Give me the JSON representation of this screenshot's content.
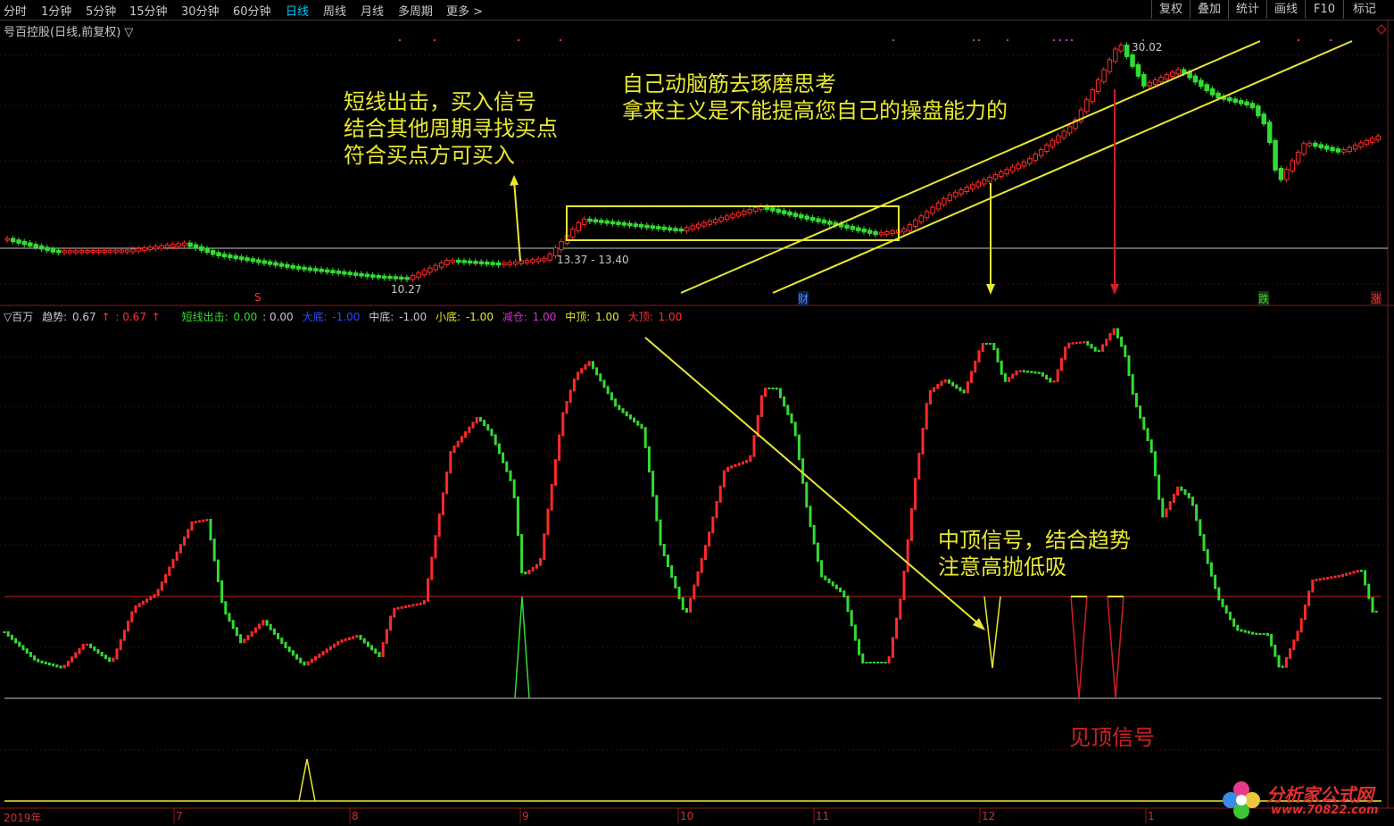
{
  "toolbar": {
    "periods": [
      "分时",
      "1分钟",
      "5分钟",
      "15分钟",
      "30分钟",
      "60分钟",
      "日线",
      "周线",
      "月线",
      "多周期",
      "更多 >"
    ],
    "active_period": "日线",
    "right_buttons": [
      "复权",
      "叠加",
      "统计",
      "画线",
      "F10",
      "标记"
    ]
  },
  "chart_title": "号百控股(日线,前复权) ▽",
  "price_chart": {
    "high_label": "30.02",
    "low_label": "10.27",
    "range_label": "13.37 - 13.40",
    "markers": {
      "s": "S",
      "cai": "财",
      "jiedie": "跌",
      "zhang": "涨"
    }
  },
  "indicator_row": {
    "name": "▽百万",
    "trend_label": "趋势:",
    "trend_value": "0.67",
    "trend_arrow": "↑",
    "trend_value2": ": 0.67",
    "short_label": "短线出击:",
    "short_value": "0.00",
    "short_value2": ": 0.00",
    "big_bottom_label": "大底:",
    "big_bottom_value": "-1.00",
    "mid_bottom_label": "中底:",
    "mid_bottom_value": "-1.00",
    "small_bottom_label": "小底:",
    "small_bottom_value": "-1.00",
    "reduce_label": "减仓:",
    "reduce_value": "1.00",
    "mid_top_label": "中顶:",
    "mid_top_value": "1.00",
    "big_top_label": "大顶:",
    "big_top_value": "1.00"
  },
  "annotations": {
    "buy_signal": [
      "短线出击，买入信号",
      "结合其他周期寻找买点",
      "符合买点方可买入"
    ],
    "think": [
      "自己动脑筋去琢磨思考",
      "拿来主义是不能提高您自己的操盘能力的"
    ],
    "mid_top": [
      "中顶信号，结合趋势",
      "注意高抛低吸"
    ],
    "see_top": "见顶信号"
  },
  "date_axis": [
    "2019年",
    "7",
    "8",
    "9",
    "10",
    "11",
    "12",
    "1"
  ],
  "watermark": {
    "line1": "分析家公式网",
    "line2": "www.70822.com"
  },
  "colors": {
    "up": "#ff2a2a",
    "down": "#32dc32",
    "annotation": "#e8e832",
    "active_tab": "#00c8ff"
  }
}
